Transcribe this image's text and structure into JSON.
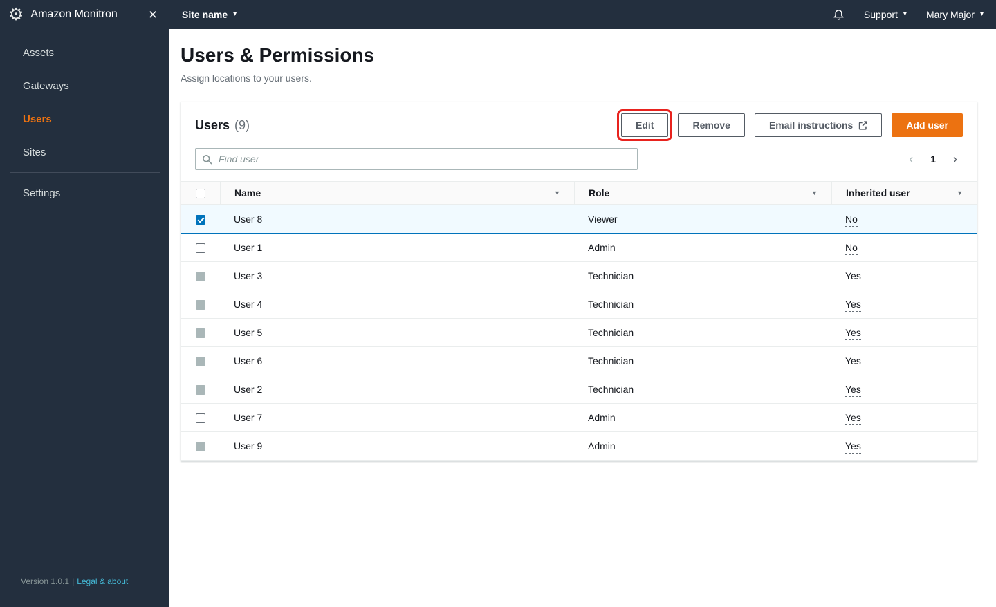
{
  "app": {
    "title": "Amazon Monitron"
  },
  "topbar": {
    "site_selector_label": "Site name",
    "support_label": "Support",
    "user_name": "Mary Major"
  },
  "sidebar": {
    "items": [
      {
        "label": "Assets"
      },
      {
        "label": "Gateways"
      },
      {
        "label": "Users"
      },
      {
        "label": "Sites"
      }
    ],
    "settings_label": "Settings",
    "footer": {
      "version": "Version 1.0.1",
      "separator": "|",
      "legal_link": "Legal & about"
    }
  },
  "page": {
    "title": "Users & Permissions",
    "subtitle": "Assign locations to your users."
  },
  "users_panel": {
    "heading": "Users",
    "count": "(9)",
    "buttons": {
      "edit": "Edit",
      "remove": "Remove",
      "email_instructions": "Email instructions",
      "add_user": "Add user"
    },
    "search_placeholder": "Find user",
    "pagination": {
      "page": "1"
    }
  },
  "table": {
    "columns": [
      "Name",
      "Role",
      "Inherited user"
    ],
    "rows": [
      {
        "name": "User 8",
        "role": "Viewer",
        "inherited": "No",
        "checkbox": "checked",
        "selected": true
      },
      {
        "name": "User 1",
        "role": "Admin",
        "inherited": "No",
        "checkbox": "unchecked",
        "selected": false
      },
      {
        "name": "User 3",
        "role": "Technician",
        "inherited": "Yes",
        "checkbox": "disabled",
        "selected": false
      },
      {
        "name": "User 4",
        "role": "Technician",
        "inherited": "Yes",
        "checkbox": "disabled",
        "selected": false
      },
      {
        "name": "User 5",
        "role": "Technician",
        "inherited": "Yes",
        "checkbox": "disabled",
        "selected": false
      },
      {
        "name": "User 6",
        "role": "Technician",
        "inherited": "Yes",
        "checkbox": "disabled",
        "selected": false
      },
      {
        "name": "User 2",
        "role": "Technician",
        "inherited": "Yes",
        "checkbox": "disabled",
        "selected": false
      },
      {
        "name": "User 7",
        "role": "Admin",
        "inherited": "Yes",
        "checkbox": "unchecked",
        "selected": false
      },
      {
        "name": "User 9",
        "role": "Admin",
        "inherited": "Yes",
        "checkbox": "disabled",
        "selected": false
      }
    ]
  },
  "glyphs": {
    "gear": "⚙",
    "close": "×",
    "caret_down": "▾",
    "sort_caret": "▼",
    "chevron_left": "‹",
    "chevron_right": "›"
  },
  "colors": {
    "topbar_bg": "#232f3e",
    "sidebar_bg": "#232f3e",
    "accent_orange": "#ec7211",
    "selected_row_bg": "#f1faff",
    "selected_row_border": "#0073bb",
    "checkbox_checked": "#0073bb",
    "annotation_red": "#e8231e",
    "link_teal": "#44b9d6",
    "secondary_button_text": "#545b64"
  }
}
